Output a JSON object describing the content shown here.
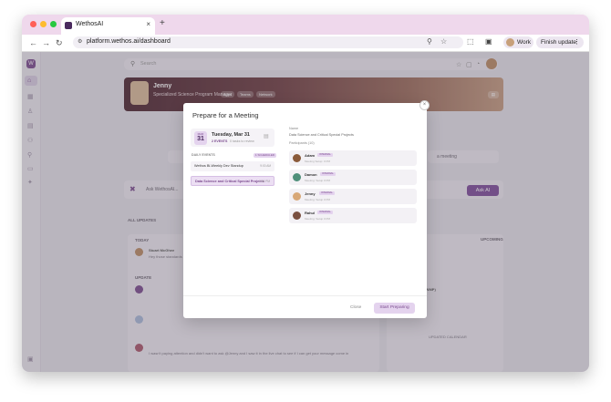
{
  "browser": {
    "tab_title": "WethosAI",
    "tab_close": "×",
    "new_tab": "+",
    "url": "platform.wethos.ai/dashboard",
    "profile_label": "Work",
    "finish_update_label": "Finish update",
    "colors": {
      "close": "#ff5f57",
      "minimize": "#febc2e",
      "maximize": "#28c840"
    }
  },
  "app": {
    "logo_text": "W",
    "search_placeholder": "Search",
    "profile": {
      "name": "Jenny",
      "subtitle": "Specialized Science Program Manager",
      "tags": [
        "Apps",
        "Teams",
        "Network"
      ]
    },
    "ask_ai_placeholder": "Ask WethosAI...",
    "ask_ai_button": "Ask AI",
    "background_meeting_text": "a meeting",
    "feed": {
      "all_updates": "ALL UPDATES",
      "today": "TODAY",
      "update_group": "UPDATE",
      "first_author": "Stuart McGhee",
      "first_text": "Hey those standards have been",
      "last_text": "I wasn't paying attention and didn't want to ask @Jenny and I saw it in the live chat to see if I can get your message come in"
    },
    "right_panel": {
      "upcoming": "UPCOMING",
      "meeting_label": "STING (WMP)",
      "calendar_link": "UPDATED CALENDAR"
    }
  },
  "modal": {
    "title": "Prepare for a Meeting",
    "close_icon": "×",
    "date": {
      "month": "MAR",
      "day": "31",
      "full": "Tuesday, Mar 31",
      "events": "2 EVENTS",
      "status": "0 tasks to review"
    },
    "events_label": "DAILY EVENTS",
    "events_chip": "1 SCHEDULED",
    "events": [
      {
        "name": "Wethos Bi-Weekly Dev Standup",
        "time": "9:00 AM",
        "selected": false
      },
      {
        "name": "Data Science and Critical Special Projects",
        "time": "2:00 PM",
        "selected": true
      }
    ],
    "name_label": "Name",
    "name_value": "Data Science and Critical Special Projects",
    "participants_label": "Participants (10)",
    "participants": [
      {
        "name": "Adam",
        "badge": "INTERNAL",
        "status": "Meeting Setup: 0 PM"
      },
      {
        "name": "Damon",
        "badge": "INTERNAL",
        "status": "Meeting: Setup 0 PM"
      },
      {
        "name": "Jenny",
        "badge": "INTERNAL",
        "status": "Meeting: Setup 0 PM"
      },
      {
        "name": "Rahul",
        "badge": "INTERNAL",
        "status": "Meeting: Setup 0 PM"
      }
    ],
    "close_label": "Close",
    "start_label": "Start Preparing",
    "accent_color": "#7a4a8e"
  }
}
